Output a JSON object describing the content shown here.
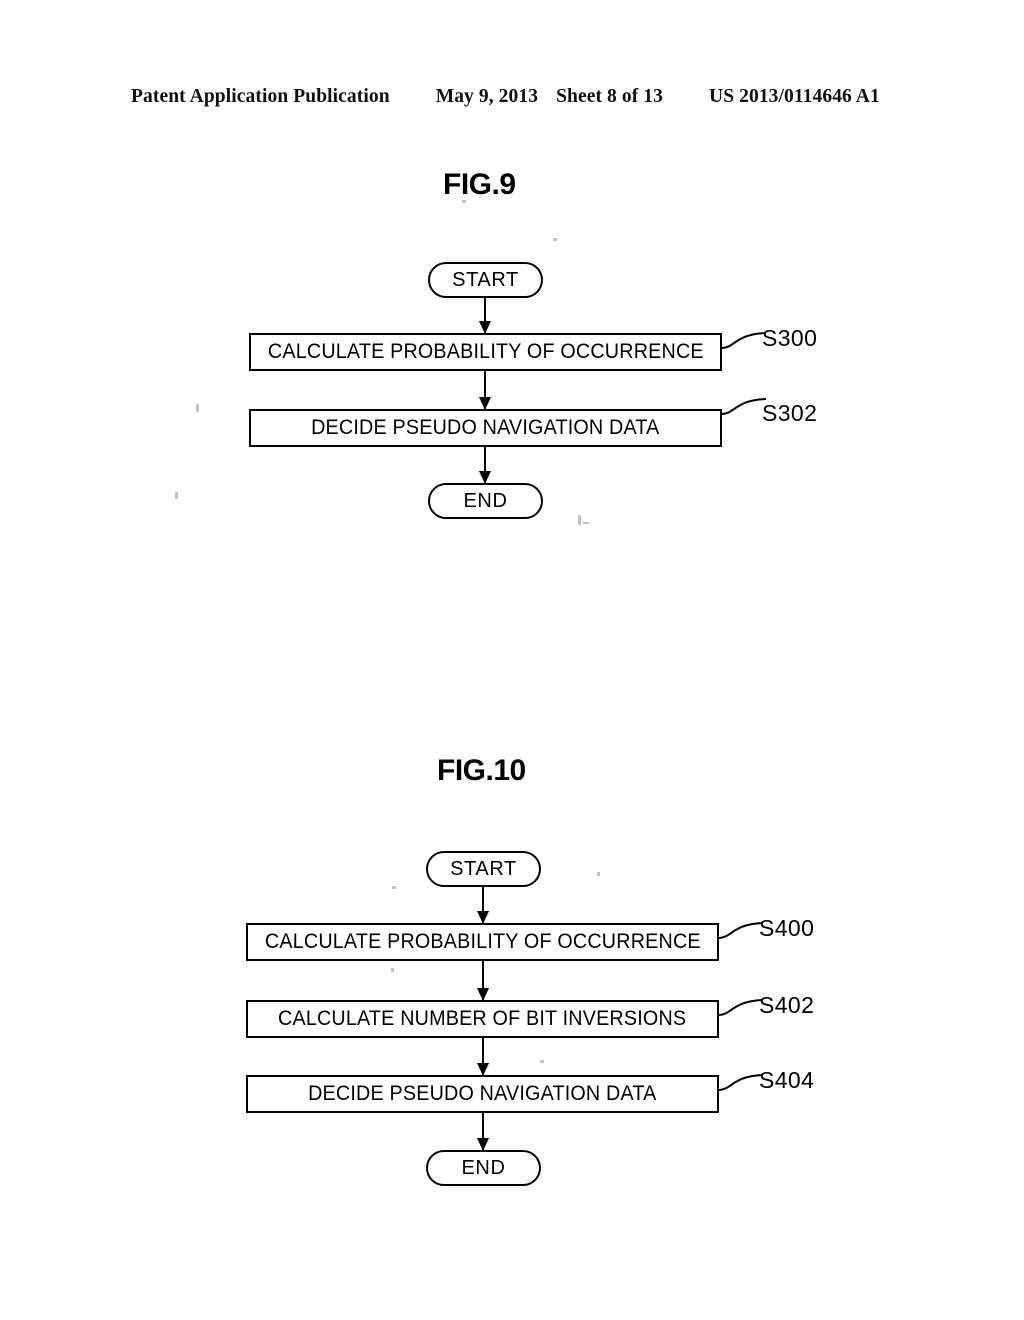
{
  "header": {
    "publication": "Patent Application Publication",
    "date": "May 9, 2013",
    "sheet": "Sheet 8 of 13",
    "document_number": "US 2013/0114646 A1"
  },
  "figures": [
    {
      "title": "FIG.9",
      "nodes": [
        {
          "id": "start9",
          "type": "terminal",
          "label": "START"
        },
        {
          "id": "s300",
          "type": "process",
          "label": "CALCULATE PROBABILITY OF OCCURRENCE",
          "ref": "S300"
        },
        {
          "id": "s302",
          "type": "process",
          "label": "DECIDE PSEUDO NAVIGATION DATA",
          "ref": "S302"
        },
        {
          "id": "end9",
          "type": "terminal",
          "label": "END"
        }
      ]
    },
    {
      "title": "FIG.10",
      "nodes": [
        {
          "id": "start10",
          "type": "terminal",
          "label": "START"
        },
        {
          "id": "s400",
          "type": "process",
          "label": "CALCULATE PROBABILITY OF OCCURRENCE",
          "ref": "S400"
        },
        {
          "id": "s402",
          "type": "process",
          "label": "CALCULATE NUMBER OF BIT INVERSIONS",
          "ref": "S402"
        },
        {
          "id": "s404",
          "type": "process",
          "label": "DECIDE PSEUDO NAVIGATION DATA",
          "ref": "S404"
        },
        {
          "id": "end10",
          "type": "terminal",
          "label": "END"
        }
      ]
    }
  ],
  "colors": {
    "ink": "#000000",
    "paper": "#ffffff"
  }
}
